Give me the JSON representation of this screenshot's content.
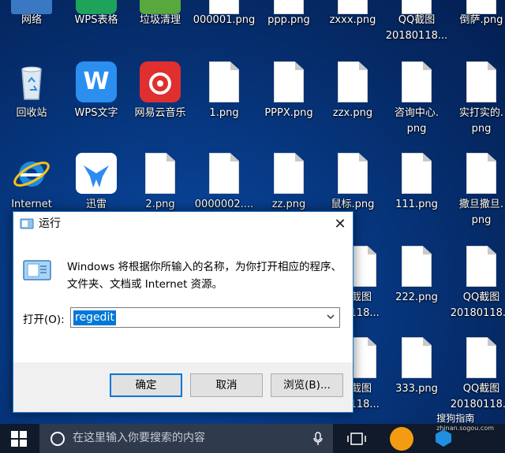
{
  "desktop": {
    "icons": [
      {
        "label": "网络",
        "kind": "network"
      },
      {
        "label": "WPS表格",
        "kind": "wps-sheet"
      },
      {
        "label": "垃圾清理",
        "kind": "cleaner"
      },
      {
        "label": "000001.png",
        "kind": "file"
      },
      {
        "label": "ppp.png",
        "kind": "file"
      },
      {
        "label": "zxxx.png",
        "kind": "file"
      },
      {
        "label": "QQ截图\n20180118...",
        "kind": "file"
      },
      {
        "label": "倒萨.png",
        "kind": "file"
      },
      {
        "label": "回收站",
        "kind": "recycle-bin"
      },
      {
        "label": "WPS文字",
        "kind": "wps-writer"
      },
      {
        "label": "网易云音乐",
        "kind": "netease-music"
      },
      {
        "label": "1.png",
        "kind": "file"
      },
      {
        "label": "PPPX.png",
        "kind": "file"
      },
      {
        "label": "zzx.png",
        "kind": "file"
      },
      {
        "label": "咨询中心.\npng",
        "kind": "file"
      },
      {
        "label": "实打实的.\npng",
        "kind": "file"
      },
      {
        "label": "Internet",
        "kind": "ie"
      },
      {
        "label": "迅雷",
        "kind": "xunlei"
      },
      {
        "label": "2.png",
        "kind": "file"
      },
      {
        "label": "0000002....",
        "kind": "file"
      },
      {
        "label": "zz.png",
        "kind": "file"
      },
      {
        "label": "鼠标.png",
        "kind": "file"
      },
      {
        "label": "111.png",
        "kind": "file"
      },
      {
        "label": "撒旦撒旦.\npng",
        "kind": "file"
      },
      {
        "label": "截图\n0118...",
        "kind": "file"
      },
      {
        "label": "222.png",
        "kind": "file"
      },
      {
        "label": "QQ截图\n20180118...",
        "kind": "file"
      },
      {
        "label": "截图\n0118...",
        "kind": "file"
      },
      {
        "label": "333.png",
        "kind": "file"
      },
      {
        "label": "QQ截图\n20180118...",
        "kind": "file"
      }
    ]
  },
  "run_dialog": {
    "title": "运行",
    "close_glyph": "✕",
    "description": "Windows 将根据你所输入的名称，为你打开相应的程序、\n文件夹、文档或 Internet 资源。",
    "open_label": "打开(O):",
    "input_value": "regedit",
    "buttons": {
      "ok": "确定",
      "cancel": "取消",
      "browse": "浏览(B)..."
    }
  },
  "taskbar": {
    "search_placeholder": "在这里输入你要搜索的内容",
    "watermark": "搜狗指南",
    "watermark_sub": "zhinan.sogou.com"
  }
}
